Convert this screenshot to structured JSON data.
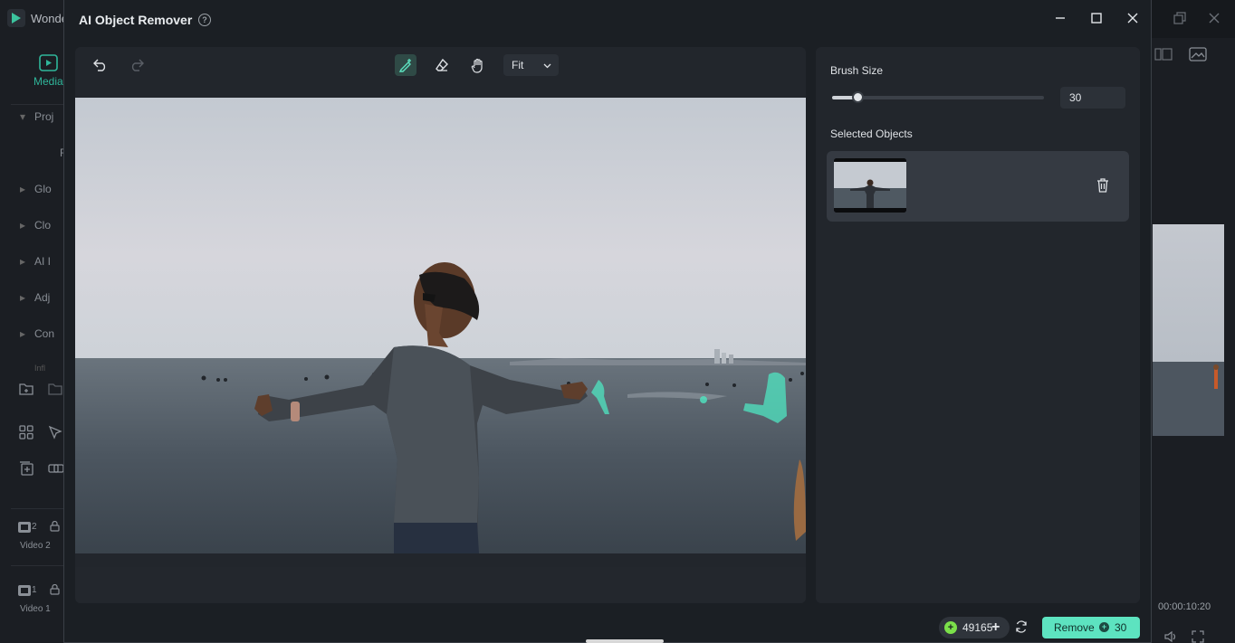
{
  "app": {
    "title": "Wonde"
  },
  "left": {
    "tab_label": "Media",
    "rows": [
      "Proj",
      "Glo",
      "Clo",
      "AI I",
      "Adj",
      "Con",
      "Infl"
    ],
    "tracks": [
      {
        "num": "2",
        "label": "Video 2"
      },
      {
        "num": "1",
        "label": "Video 1"
      }
    ]
  },
  "right": {
    "timecode": "00:00:10:20"
  },
  "dialog": {
    "title": "AI Object Remover",
    "help_icon": "?",
    "toolbar": {
      "tools": [
        "undo-icon",
        "redo-icon",
        "smart-brush-icon",
        "eraser-icon",
        "hand-icon"
      ],
      "zoom_value": "Fit"
    },
    "brush_size": {
      "label": "Brush Size",
      "value": "30",
      "level": 0.12
    },
    "selected_objects": {
      "label": "Selected Objects",
      "count": 1
    },
    "footer": {
      "credits": "49165",
      "remove_label": "Remove",
      "remove_cost": "30"
    }
  },
  "colors": {
    "accent": "#5de3c0",
    "credit_green": "#7be04a",
    "panel": "#22262c",
    "dialog_bg": "#1b1f24"
  }
}
